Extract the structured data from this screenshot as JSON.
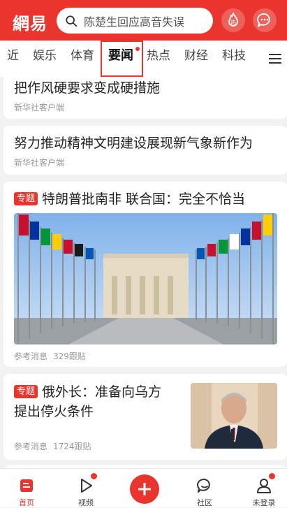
{
  "header": {
    "logo_text": "網易",
    "search_placeholder": "陈楚生回应高音失误",
    "hot_label": "热"
  },
  "tabs": [
    {
      "label": "近"
    },
    {
      "label": "娱乐"
    },
    {
      "label": "体育"
    },
    {
      "label": "要闻",
      "active": true,
      "has_dot": true
    },
    {
      "label": "热点"
    },
    {
      "label": "财经"
    },
    {
      "label": "科技"
    }
  ],
  "feed": [
    {
      "title": "把作风硬要求变成硬措施",
      "source": "新华社客户端"
    },
    {
      "title": "努力推动精神文明建设展现新气象新作为",
      "source": "新华社客户端"
    },
    {
      "badge": "专题",
      "title": "特朗普批南非 联合国：完全不恰当",
      "source": "参考消息",
      "comments": "329跟贴"
    },
    {
      "badge": "专题",
      "title_line1": "俄外长：准备向乌方",
      "title_line2": "提出停火条件",
      "source": "参考消息",
      "comments": "1724跟贴"
    }
  ],
  "bottom_nav": {
    "home": "首页",
    "video": "视频",
    "community": "社区",
    "login": "未登录"
  },
  "colors": {
    "brand_red": "#e9352d",
    "background": "#f2f2f2"
  },
  "icons": [
    "search-icon",
    "hot-icon",
    "message-icon",
    "menu-icon",
    "home-icon",
    "video-icon",
    "plus-icon",
    "community-icon",
    "user-icon"
  ]
}
